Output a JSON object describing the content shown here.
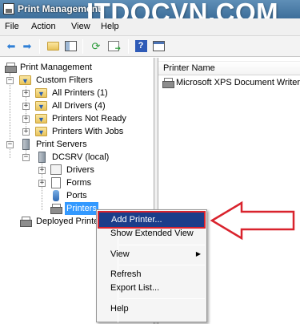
{
  "window": {
    "title": "Print Management",
    "watermark": "ITDOCVN.COM"
  },
  "menu": {
    "items": [
      "File",
      "Action",
      "View",
      "Help"
    ]
  },
  "toolbar": {
    "buttons": [
      "back-arrow-icon",
      "forward-arrow-icon",
      "up-folder-icon",
      "show-hide-tree-icon",
      "refresh-icon",
      "export-icon",
      "help-icon",
      "pane-icon"
    ]
  },
  "tree": {
    "root": "Print Management",
    "custom_filters": "Custom Filters",
    "all_printers": "All Printers (1)",
    "all_drivers": "All Drivers (4)",
    "not_ready": "Printers Not Ready",
    "with_jobs": "Printers With Jobs",
    "print_servers": "Print Servers",
    "server": "DCSRV (local)",
    "drivers": "Drivers",
    "forms": "Forms",
    "ports": "Ports",
    "printers": "Printers",
    "deployed": "Deployed Printe"
  },
  "list": {
    "column_header": "Printer Name",
    "rows": [
      "Microsoft XPS Document Writer"
    ]
  },
  "context_menu": {
    "add_printer": "Add Printer...",
    "show_extended": "Show Extended View",
    "view": "View",
    "refresh": "Refresh",
    "export": "Export List...",
    "help": "Help"
  },
  "colors": {
    "highlight": "#1b3d8a",
    "annotation": "#d9232d",
    "selection": "#3399ff"
  }
}
